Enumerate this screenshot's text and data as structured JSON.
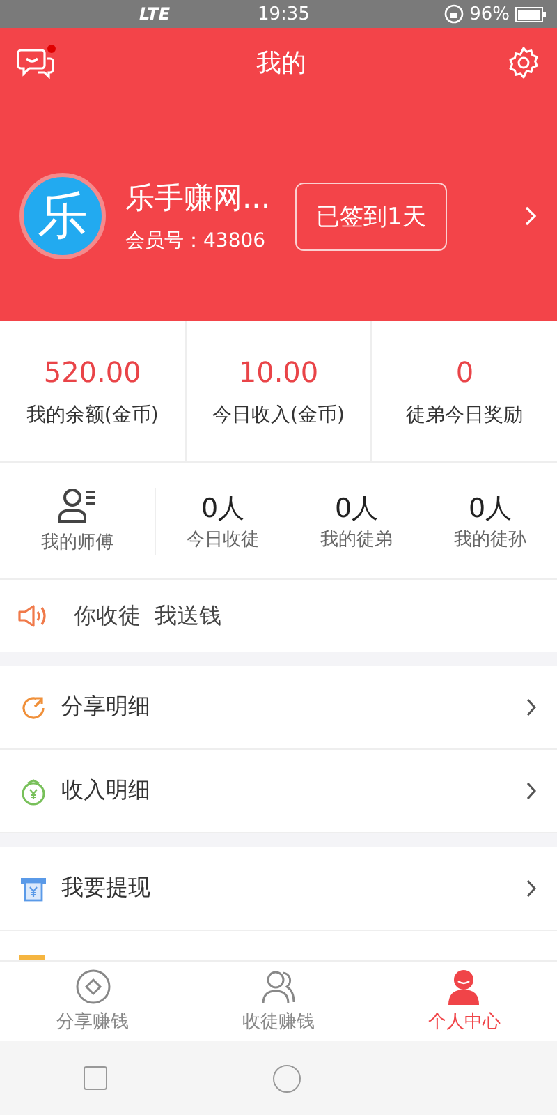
{
  "status_bar": {
    "network": "LTE",
    "time": "19:35",
    "battery": "96%"
  },
  "header": {
    "title": "我的",
    "has_unread_messages": true
  },
  "profile": {
    "avatar_text": "乐",
    "name": "乐手赚网...",
    "member_id": "会员号：43806",
    "checkin_button": "已签到1天"
  },
  "balances": [
    {
      "value": "520.00",
      "label": "我的余额(金币)"
    },
    {
      "value": "10.00",
      "label": "今日收入(金币)"
    },
    {
      "value": "0",
      "label": "徒弟今日奖励"
    }
  ],
  "team": {
    "master_label": "我的师傅",
    "stats": [
      {
        "value": "0人",
        "label": "今日收徒"
      },
      {
        "value": "0人",
        "label": "我的徒弟"
      },
      {
        "value": "0人",
        "label": "我的徒孙"
      }
    ]
  },
  "notice": {
    "text": "你收徒  我送钱"
  },
  "menu_groups": [
    [
      {
        "kind": "share",
        "label": "分享明细"
      },
      {
        "kind": "income",
        "label": "收入明细"
      }
    ],
    [
      {
        "kind": "withdraw",
        "label": "我要提现"
      }
    ]
  ],
  "tabs": [
    {
      "kind": "share",
      "label": "分享赚钱",
      "selected": false
    },
    {
      "kind": "recruit",
      "label": "收徒赚钱",
      "selected": false
    },
    {
      "kind": "profile",
      "label": "个人中心",
      "selected": true
    }
  ]
}
